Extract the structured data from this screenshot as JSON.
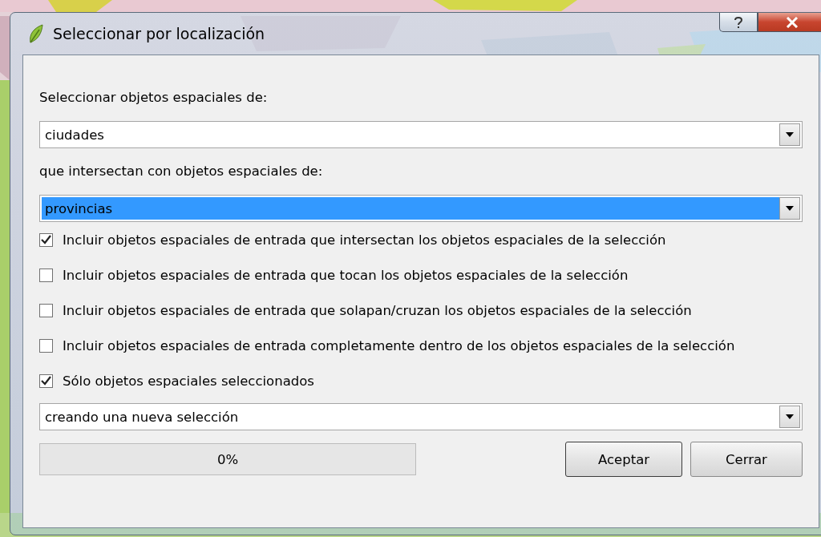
{
  "window": {
    "title": "Seleccionar por localización"
  },
  "content": [
    {
      "kind": "label",
      "text": "Seleccionar objetos espaciales de:"
    },
    {
      "kind": "combo",
      "value": "ciudades",
      "selected": false
    },
    {
      "kind": "label",
      "text": "que intersectan con objetos espaciales de:"
    },
    {
      "kind": "combo",
      "value": "provincias",
      "selected": true
    },
    {
      "kind": "checkbox",
      "label": "Incluir objetos espaciales de entrada que intersectan los objetos espaciales de la selección",
      "checked": true
    },
    {
      "kind": "checkbox",
      "label": "Incluir objetos espaciales de entrada que tocan los objetos espaciales de la selección",
      "checked": false
    },
    {
      "kind": "checkbox",
      "label": "Incluir objetos espaciales de entrada que solapan/cruzan los objetos espaciales de la selección",
      "checked": false
    },
    {
      "kind": "checkbox",
      "label": "Incluir objetos espaciales de entrada completamente dentro de los objetos espaciales de la selección",
      "checked": false
    },
    {
      "kind": "checkbox",
      "label": "Sólo objetos espaciales seleccionados",
      "checked": true
    },
    {
      "kind": "combo",
      "value": "creando una nueva selección",
      "selected": false
    }
  ],
  "progress": {
    "text": "0%",
    "level": 0
  },
  "buttons": [
    "Aceptar",
    "Cerrar"
  ]
}
